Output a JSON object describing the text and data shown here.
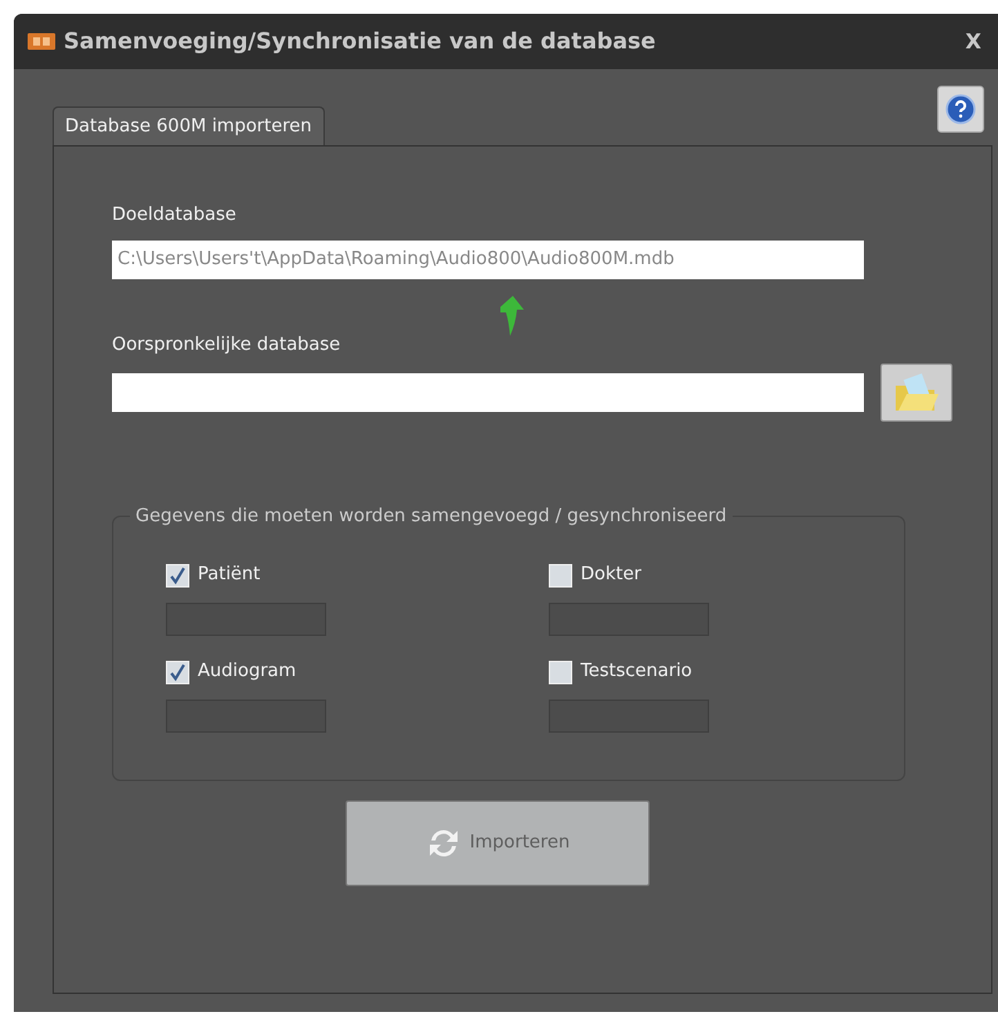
{
  "window": {
    "title": "Samenvoeging/Synchronisatie van de database",
    "close": "X"
  },
  "tabs": [
    {
      "label": "Database 600M importeren",
      "selected": true
    }
  ],
  "target": {
    "label": "Doeldatabase",
    "value": "C:\\Users\\Users't\\AppData\\Roaming\\Audio800\\Audio800M.mdb"
  },
  "source": {
    "label": "Oorspronkelijke database"
  },
  "group": {
    "legend": "Gegevens die moeten worden samengevoegd / gesynchroniseerd",
    "items": [
      {
        "label": "Patiënt",
        "checked": true,
        "level": 0
      },
      {
        "label": "Dokter",
        "checked": false,
        "level": 0
      },
      {
        "label": "Audiogram",
        "checked": true,
        "level": 0
      },
      {
        "label": "Testscenario",
        "checked": false,
        "level": 0
      }
    ]
  },
  "import_button": {
    "label": "Importeren",
    "disabled": true
  }
}
